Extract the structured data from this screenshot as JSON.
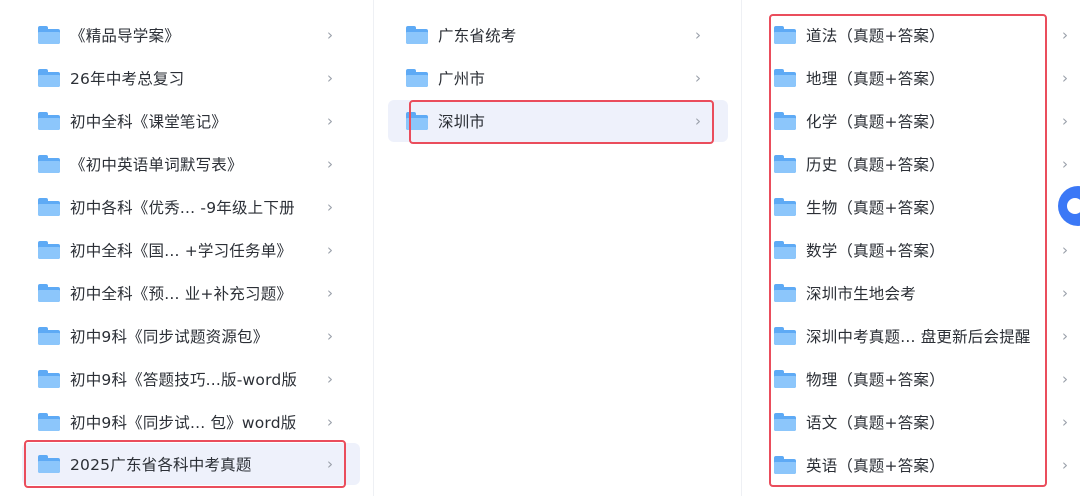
{
  "column1": {
    "items": [
      {
        "label": "《精品导学案》"
      },
      {
        "label": "26年中考总复习"
      },
      {
        "label": "初中全科《课堂笔记》"
      },
      {
        "label": "《初中英语单词默写表》"
      },
      {
        "label": "初中各科《优秀...  -9年级上下册"
      },
      {
        "label": "初中全科《国...   +学习任务单》"
      },
      {
        "label": "初中全科《预...   业+补充习题》"
      },
      {
        "label": "初中9科《同步试题资源包》"
      },
      {
        "label": "初中9科《答题技巧...版-word版"
      },
      {
        "label": "初中9科《同步试...  包》word版"
      },
      {
        "label": "2025广东省各科中考真题"
      }
    ]
  },
  "column2": {
    "items": [
      {
        "label": "广东省统考"
      },
      {
        "label": "广州市"
      },
      {
        "label": "深圳市"
      }
    ]
  },
  "column3": {
    "items": [
      {
        "label": "道法（真题+答案）"
      },
      {
        "label": "地理（真题+答案）"
      },
      {
        "label": "化学（真题+答案）"
      },
      {
        "label": "历史（真题+答案）"
      },
      {
        "label": "生物（真题+答案）"
      },
      {
        "label": "数学（真题+答案）"
      },
      {
        "label": "深圳市生地会考"
      },
      {
        "label": "深圳中考真题...  盘更新后会提醒"
      },
      {
        "label": "物理（真题+答案）"
      },
      {
        "label": "语文（真题+答案）"
      },
      {
        "label": "英语（真题+答案）"
      }
    ]
  },
  "chevron": "›",
  "icons": {
    "folder": "folder-icon",
    "chevron": "chevron-right-icon",
    "fab": "floating-assistant-icon"
  },
  "colors": {
    "folder": "#5eaaf5",
    "highlight_box": "#ea4d5c",
    "selected_bg": "#eef1fb",
    "fab": "#3b78f6"
  }
}
